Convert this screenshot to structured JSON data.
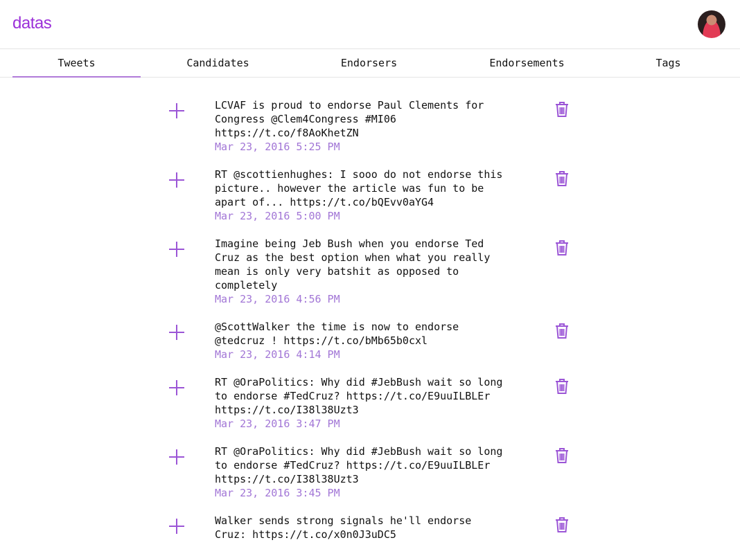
{
  "app": {
    "logo": "datas"
  },
  "tabs": [
    {
      "label": "Tweets"
    },
    {
      "label": "Candidates"
    },
    {
      "label": "Endorsers"
    },
    {
      "label": "Endorsements"
    },
    {
      "label": "Tags"
    }
  ],
  "active_tab": "Tweets",
  "colors": {
    "accent": "#9b30d9",
    "date": "#a276d6",
    "icon": "#9b55d6"
  },
  "tweets": [
    {
      "text": "LCVAF is proud to endorse Paul Clements for\nCongress @Clem4Congress #MI06\nhttps://t.co/f8AoKhetZN",
      "date": "Mar 23, 2016 5:25 PM"
    },
    {
      "text": "RT @scottienhughes: I sooo do not endorse this\npicture.. however the article was fun to be\napart of... https://t.co/bQEvv0aYG4",
      "date": "Mar 23, 2016 5:00 PM"
    },
    {
      "text": "Imagine being Jeb Bush when you endorse Ted\nCruz as the best option when what you really\nmean is only very batshit as opposed to\ncompletely",
      "date": "Mar 23, 2016 4:56 PM"
    },
    {
      "text": "@ScottWalker the time is now to endorse\n@tedcruz ! https://t.co/bMb65b0cxl",
      "date": "Mar 23, 2016 4:14 PM"
    },
    {
      "text": "RT @OraPolitics: Why did #JebBush wait so long\nto endorse #TedCruz? https://t.co/E9uuILBLEr\nhttps://t.co/I38l38Uzt3",
      "date": "Mar 23, 2016 3:47 PM"
    },
    {
      "text": "RT @OraPolitics: Why did #JebBush wait so long\nto endorse #TedCruz? https://t.co/E9uuILBLEr\nhttps://t.co/I38l38Uzt3",
      "date": "Mar 23, 2016 3:45 PM"
    },
    {
      "text": "Walker sends strong signals he'll endorse\nCruz: https://t.co/x0n0J3uDC5",
      "date": ""
    }
  ]
}
